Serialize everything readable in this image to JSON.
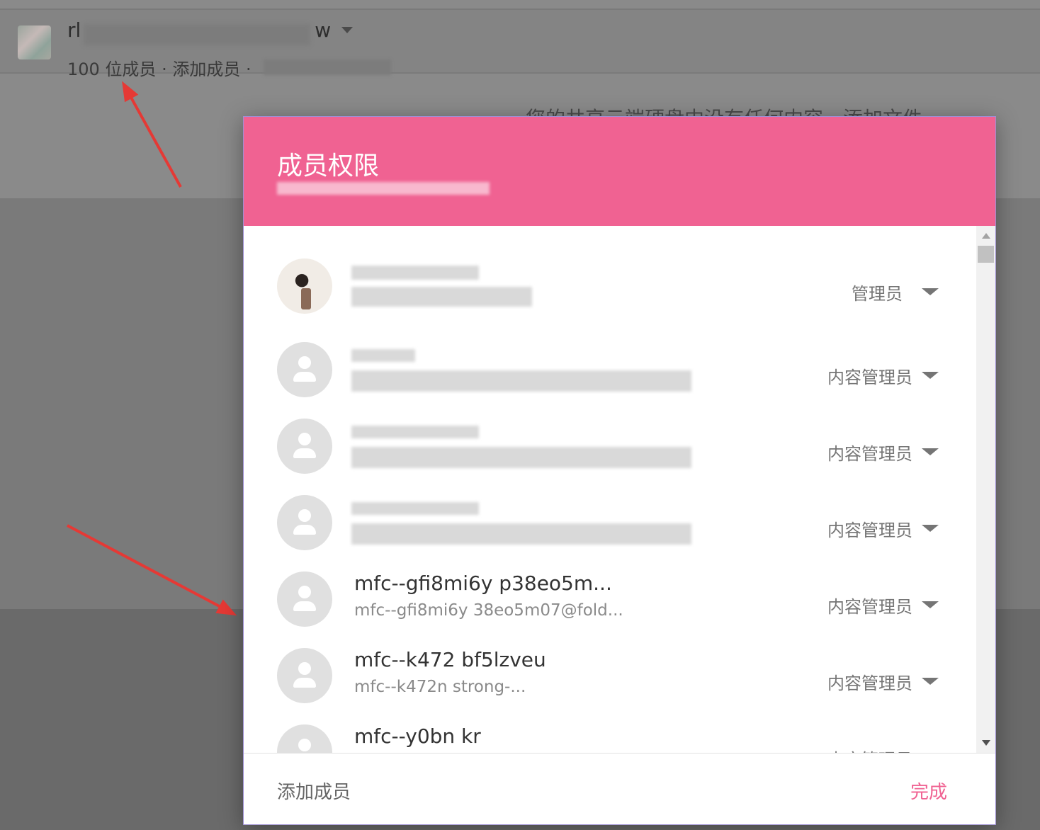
{
  "background": {
    "group_title": "rl",
    "group_title_end": "w",
    "group_sub": "100 位成员 · 添加成员 · ",
    "notice": "您的共享云端硬盘中没有任何内容，添加文件"
  },
  "dialog": {
    "title": "成员权限",
    "members": [
      {
        "name": "",
        "email": "",
        "role": "管理员",
        "avatar": "photo"
      },
      {
        "name": "",
        "email": "",
        "role": "内容管理员",
        "avatar": "person-icon"
      },
      {
        "name": "",
        "email": "",
        "role": "内容管理员",
        "avatar": "person-icon"
      },
      {
        "name": "",
        "email": "",
        "role": "内容管理员",
        "avatar": "person-icon"
      },
      {
        "name": "mfc--gfi8mi6y     p38eo5m...",
        "email": "mfc--gfi8mi6y        38eo5m07@fold...",
        "role": "内容管理员",
        "avatar": "person-icon"
      },
      {
        "name": "mfc--k472        bf5lzveu",
        "email": "mfc--k472n              strong-...",
        "role": "内容管理员",
        "avatar": "person-icon"
      },
      {
        "name": "mfc--y0bn                 kr",
        "email": "",
        "role": "内容管理员",
        "avatar": "person-icon"
      }
    ],
    "footer": {
      "add_label": "添加成员",
      "done_label": "完成"
    }
  },
  "colors": {
    "accent": "#f06292",
    "annotation_arrow": "#e53935"
  }
}
